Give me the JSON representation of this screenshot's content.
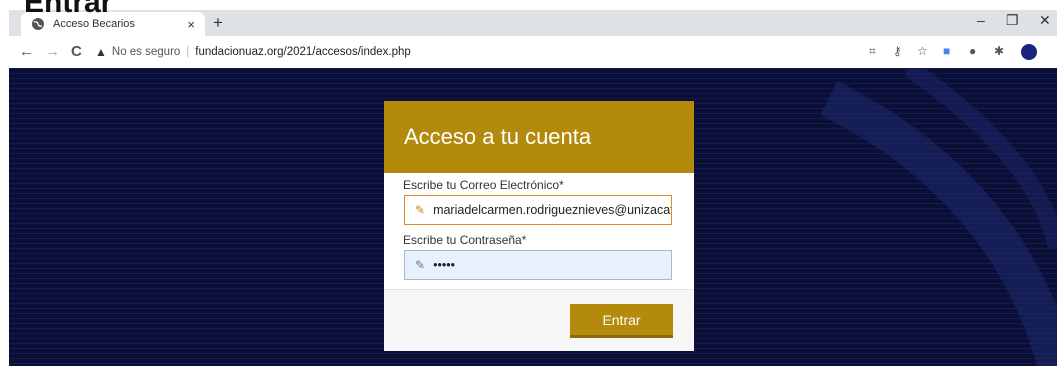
{
  "overlay_title": "Entrar",
  "browser": {
    "tab_title": "Acceso Becarios",
    "tab_close": "×",
    "new_tab": "+",
    "window_controls": [
      "–",
      "❐",
      "✕"
    ],
    "nav": {
      "back": "←",
      "forward": "→",
      "reload": "C"
    },
    "security_label": "No es seguro",
    "url": "fundacionuaz.org/2021/accesos/index.php",
    "toolbar_icons": [
      "qr-icon",
      "key-icon",
      "star-icon",
      "translate-icon",
      "extension-badge-icon",
      "puzzle-icon",
      "profile-icon",
      "menu-icon"
    ]
  },
  "login": {
    "title": "Acceso a tu cuenta",
    "email_label": "Escribe tu Correo Electrónico*",
    "email_value": "mariadelcarmen.rodrigueznieves@unizacatecas",
    "password_label": "Escribe tu Contraseña*",
    "password_value": "•••••",
    "submit_label": "Entrar"
  },
  "colors": {
    "accent": "#b38a0b",
    "background": "#0b0f35"
  }
}
